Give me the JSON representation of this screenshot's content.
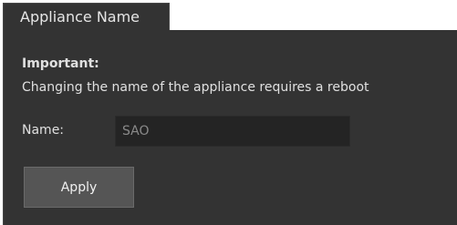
{
  "tab": {
    "title": "Appliance Name"
  },
  "notice": {
    "heading": "Important:",
    "text": "Changing the name of the appliance requires a reboot"
  },
  "name_field": {
    "label": "Name:",
    "value": "SAO"
  },
  "actions": {
    "apply_label": "Apply"
  },
  "colors": {
    "panel_background": "#333333",
    "input_background": "#242424",
    "button_background": "#555555",
    "text": "#e0e0e0"
  }
}
